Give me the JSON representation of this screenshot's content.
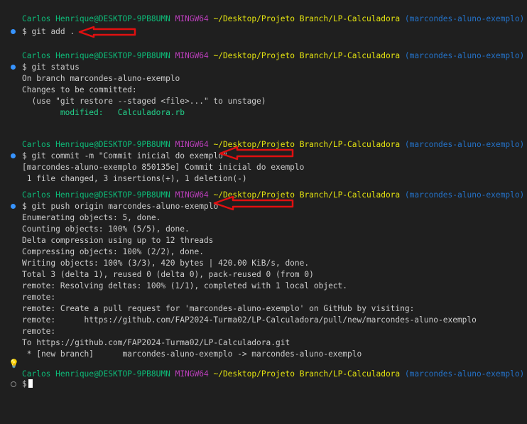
{
  "prompt": {
    "user": "Carlos Henrique@DESKTOP-9PB8UMN",
    "system": "MINGW64",
    "path": "~/Desktop/Projeto Branch/LP-Calculadora",
    "branch": "(marcondes-aluno-exemplo)",
    "symbol": "$"
  },
  "commands": {
    "add": "git add .",
    "status": "git status",
    "commit": "git commit -m \"Commit inicial do exemplo\"",
    "push": "git push origin marcondes-aluno-exemplo"
  },
  "status_output": {
    "on_branch": "On branch marcondes-aluno-exemplo",
    "changes": "Changes to be committed:",
    "hint": "  (use \"git restore --staged <file>...\" to unstage)",
    "modified_label": "        modified:   ",
    "modified_file": "Calculadora.rb"
  },
  "commit_output": [
    "[marcondes-aluno-exemplo 850135e] Commit inicial do exemplo",
    " 1 file changed, 3 insertions(+), 1 deletion(-)"
  ],
  "push_output": [
    "Enumerating objects: 5, done.",
    "Counting objects: 100% (5/5), done.",
    "Delta compression using up to 12 threads",
    "Compressing objects: 100% (2/2), done.",
    "Writing objects: 100% (3/3), 420 bytes | 420.00 KiB/s, done.",
    "Total 3 (delta 1), reused 0 (delta 0), pack-reused 0 (from 0)",
    "remote: Resolving deltas: 100% (1/1), completed with 1 local object.",
    "remote:",
    "remote: Create a pull request for 'marcondes-aluno-exemplo' on GitHub by visiting:",
    "remote:      https://github.com/FAP2024-Turma02/LP-Calculadora/pull/new/marcondes-aluno-exemplo",
    "remote:",
    "To https://github.com/FAP2024-Turma02/LP-Calculadora.git",
    " * [new branch]      marcondes-aluno-exemplo -> marcondes-aluno-exemplo"
  ],
  "colors": {
    "background": "#1f1f1f",
    "user": "#0dbc79",
    "host": "#bc3fbc",
    "path": "#e5e510",
    "branch": "#2472c8",
    "modified": "#23d18b",
    "decoration_dot": "#3794ff",
    "annotation_arrow": "#e01010"
  },
  "icons": {
    "success_marker": "blue-dot-icon",
    "idle_marker": "empty-circle-icon",
    "hint": "lightbulb-icon",
    "annotation": "red-arrow-icon"
  }
}
